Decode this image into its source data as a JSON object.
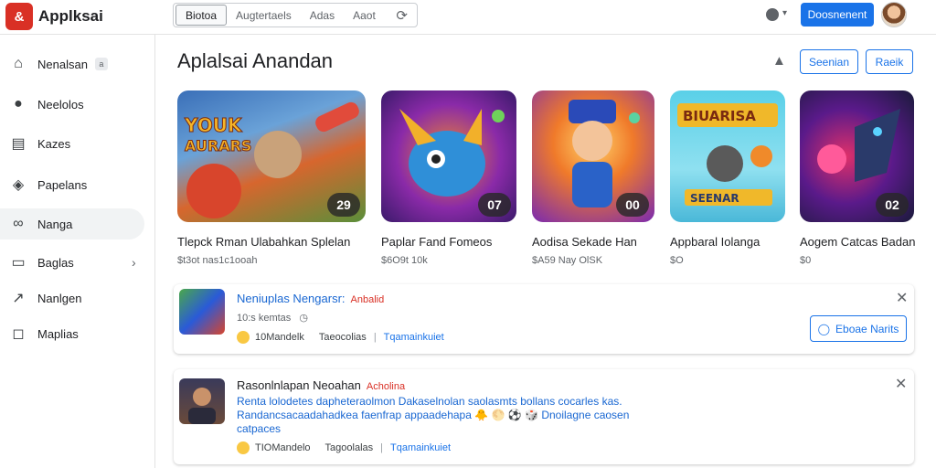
{
  "app": {
    "logo": "&",
    "title": "Applksai"
  },
  "tabs": [
    "Biotoa",
    "Augtertaels",
    "Adas",
    "Aaot"
  ],
  "topbar": {
    "button_label": "Doosnenent",
    "refresh_icon": "refresh-icon",
    "status_caret": "▾"
  },
  "sidebar": {
    "items": [
      {
        "icon": "home-icon",
        "glyph": "⌂",
        "label": "Nenalsan",
        "badge": "a"
      },
      {
        "icon": "soccer-ball-icon",
        "glyph": "⚽",
        "label": "Neelolos"
      },
      {
        "icon": "news-icon",
        "glyph": "▤",
        "label": "Kazes"
      },
      {
        "icon": "tag-icon",
        "glyph": "◈",
        "label": "Papelans"
      },
      {
        "icon": "infinity-icon",
        "glyph": "∞",
        "label": "Nanga"
      },
      {
        "icon": "folder-icon",
        "glyph": "▭",
        "label": "Baglas",
        "chevron": "›"
      },
      {
        "icon": "share-icon",
        "glyph": "↗",
        "label": "Nanlgen"
      },
      {
        "icon": "square-icon",
        "glyph": "◻",
        "label": "Maplias"
      }
    ]
  },
  "main": {
    "title": "Aplalsai Anandan",
    "buttons": {
      "primary": "Seenian",
      "secondary": "Raeik"
    }
  },
  "cards": [
    {
      "name": "Tlepck Rman Ulabahkan Splelan",
      "sub": "$t3ot nas1c1ooah",
      "rating": "29",
      "art_text": "YOUK AURARS"
    },
    {
      "name": "Paplar Fand Fomeos",
      "sub": "$6O9t 10k",
      "rating": "07",
      "art_text": ""
    },
    {
      "name": "Aodisa Sekade Han",
      "sub": "$A59 Nay OlSK",
      "rating": "00",
      "art_text": ""
    },
    {
      "name": "Appbaral Iolanga",
      "sub": "$O",
      "rating": "",
      "art_text": "BIUARISA SEENAR"
    },
    {
      "name": "Aogem Catcas Badan",
      "sub": "$0",
      "rating": "02",
      "art_text": ""
    }
  ],
  "notifications": [
    {
      "title": "Neniuplas Nengarsr:",
      "tag": "Anbalid",
      "meta": "10:s kemtas",
      "stats_left": "10Mandelk",
      "stats_mid": "Taeocolias",
      "stats_link": "Tqamainkuiet",
      "button": "Eboae Narits",
      "close": "✕"
    },
    {
      "title": "Rasonlnlapan Neoahan",
      "tag": "Acholina",
      "text": "Renta lolodetes dapheteraolmon Dakaselnolan saolasmts bollans cocarles kas. Randancsacaadahadkea faenfrap appaadehapa 🐥 🌕 ⚽ 🎲 Dnoilagne caosen catpaces",
      "stats_left": "TIOMandelo",
      "stats_mid": "Tagoolalas",
      "stats_link": "Tqamainkuiet",
      "close": "✕"
    }
  ]
}
